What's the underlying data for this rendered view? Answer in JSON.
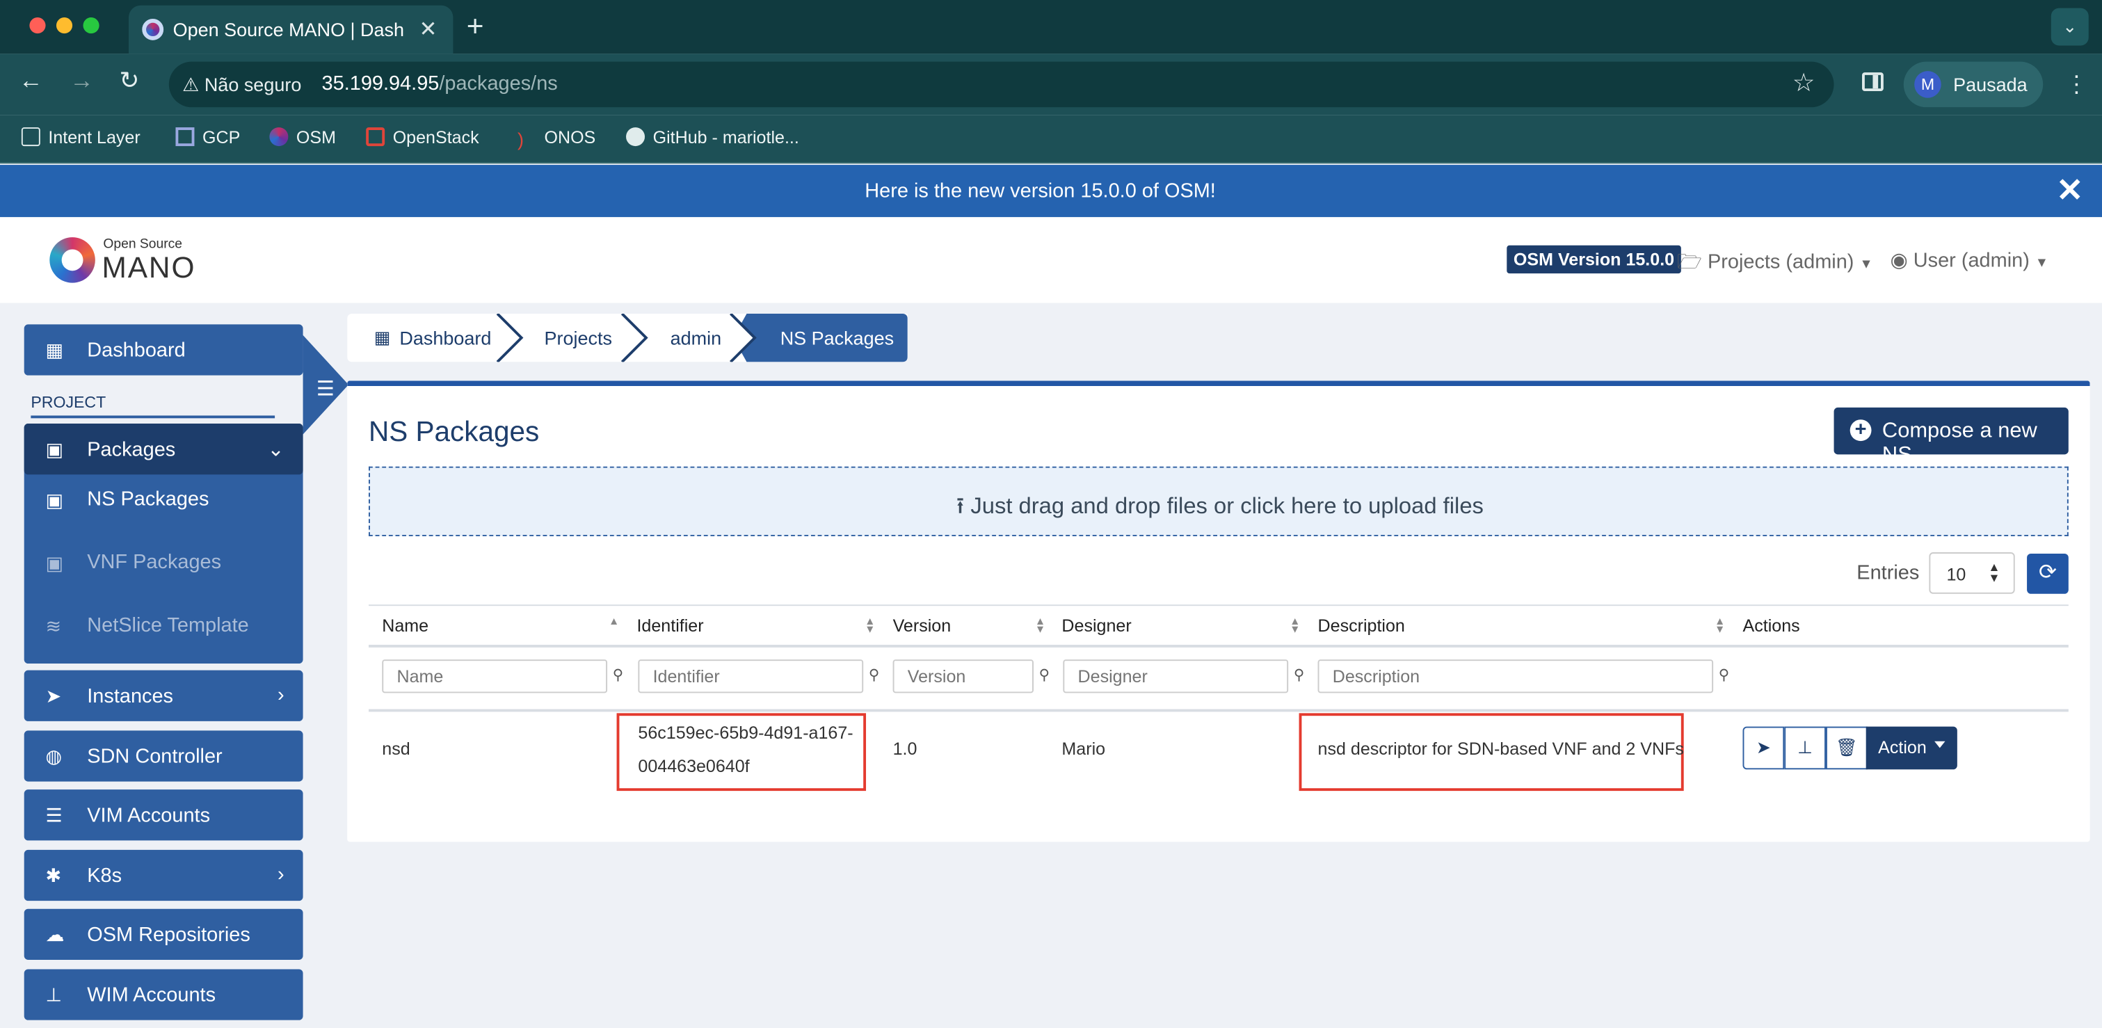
{
  "browser": {
    "tab_title": "Open Source MANO | Dashboard",
    "url_host": "35.199.94.95",
    "url_path": "/packages/ns",
    "security_label": "Não seguro",
    "profile_initial": "M",
    "profile_name": "Pausada",
    "bookmarks": [
      "Intent Layer",
      "GCP",
      "OSM",
      "OpenStack",
      "ONOS",
      "GitHub - mariotle..."
    ]
  },
  "banner": {
    "message": "Here is the new version 15.0.0 of OSM!"
  },
  "header": {
    "logo_small": "Open Source",
    "logo_large": "MANO",
    "version": "OSM Version 15.0.0",
    "projects": "Projects (admin)",
    "user": "User (admin)"
  },
  "sidebar": {
    "dashboard": "Dashboard",
    "section": "PROJECT",
    "packages": "Packages",
    "sub": [
      "NS Packages",
      "VNF Packages",
      "NetSlice Template"
    ],
    "items": [
      "Instances",
      "SDN Controller",
      "VIM Accounts",
      "K8s",
      "OSM Repositories",
      "WIM Accounts"
    ]
  },
  "breadcrumb": [
    "Dashboard",
    "Projects",
    "admin",
    "NS Packages"
  ],
  "page": {
    "title": "NS Packages",
    "compose_label": "Compose a new NS",
    "drop_label": "Just drag and drop files or click here to upload files",
    "entries_label": "Entries",
    "entries_value": "10"
  },
  "table": {
    "headers": [
      "Name",
      "Identifier",
      "Version",
      "Designer",
      "Description",
      "Actions"
    ],
    "placeholders": [
      "Name",
      "Identifier",
      "Version",
      "Designer",
      "Description"
    ],
    "rows": [
      {
        "name": "nsd",
        "identifier_line1": "56c159ec-65b9-4d91-a167-",
        "identifier_line2": "004463e0640f",
        "version": "1.0",
        "designer": "Mario",
        "description": "nsd descriptor for SDN-based VNF and 2 VNFs"
      }
    ],
    "action_label": "Action"
  },
  "colors": {
    "primary": "#2f5fa1",
    "dark": "#1d3d6b",
    "banner": "#2563b0",
    "highlight": "#e43b2f"
  }
}
